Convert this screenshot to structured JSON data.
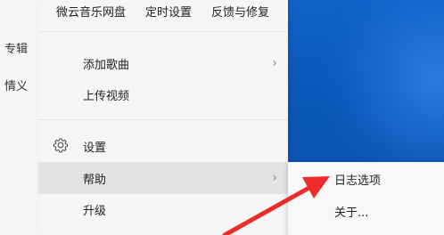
{
  "app_left": {
    "items": [
      "专辑",
      "情义"
    ]
  },
  "menu": {
    "top": [
      "微云音乐网盘",
      "定时设置",
      "反馈与修复"
    ],
    "items": [
      {
        "label": "添加歌曲",
        "has_submenu": true
      },
      {
        "label": "上传视频",
        "has_submenu": false
      },
      {
        "label": "设置",
        "has_submenu": false,
        "icon": "gear-icon"
      },
      {
        "label": "帮助",
        "has_submenu": true,
        "active": true
      },
      {
        "label": "升级",
        "has_submenu": false
      }
    ]
  },
  "submenu": {
    "items": [
      "日志选项",
      "关于..."
    ]
  },
  "colors": {
    "desktop": "#0a57b8",
    "menu_bg": "#f6f6f6",
    "active_bg": "#e3e3e3",
    "arrow": "#ee2b2b"
  },
  "chevron": "›"
}
